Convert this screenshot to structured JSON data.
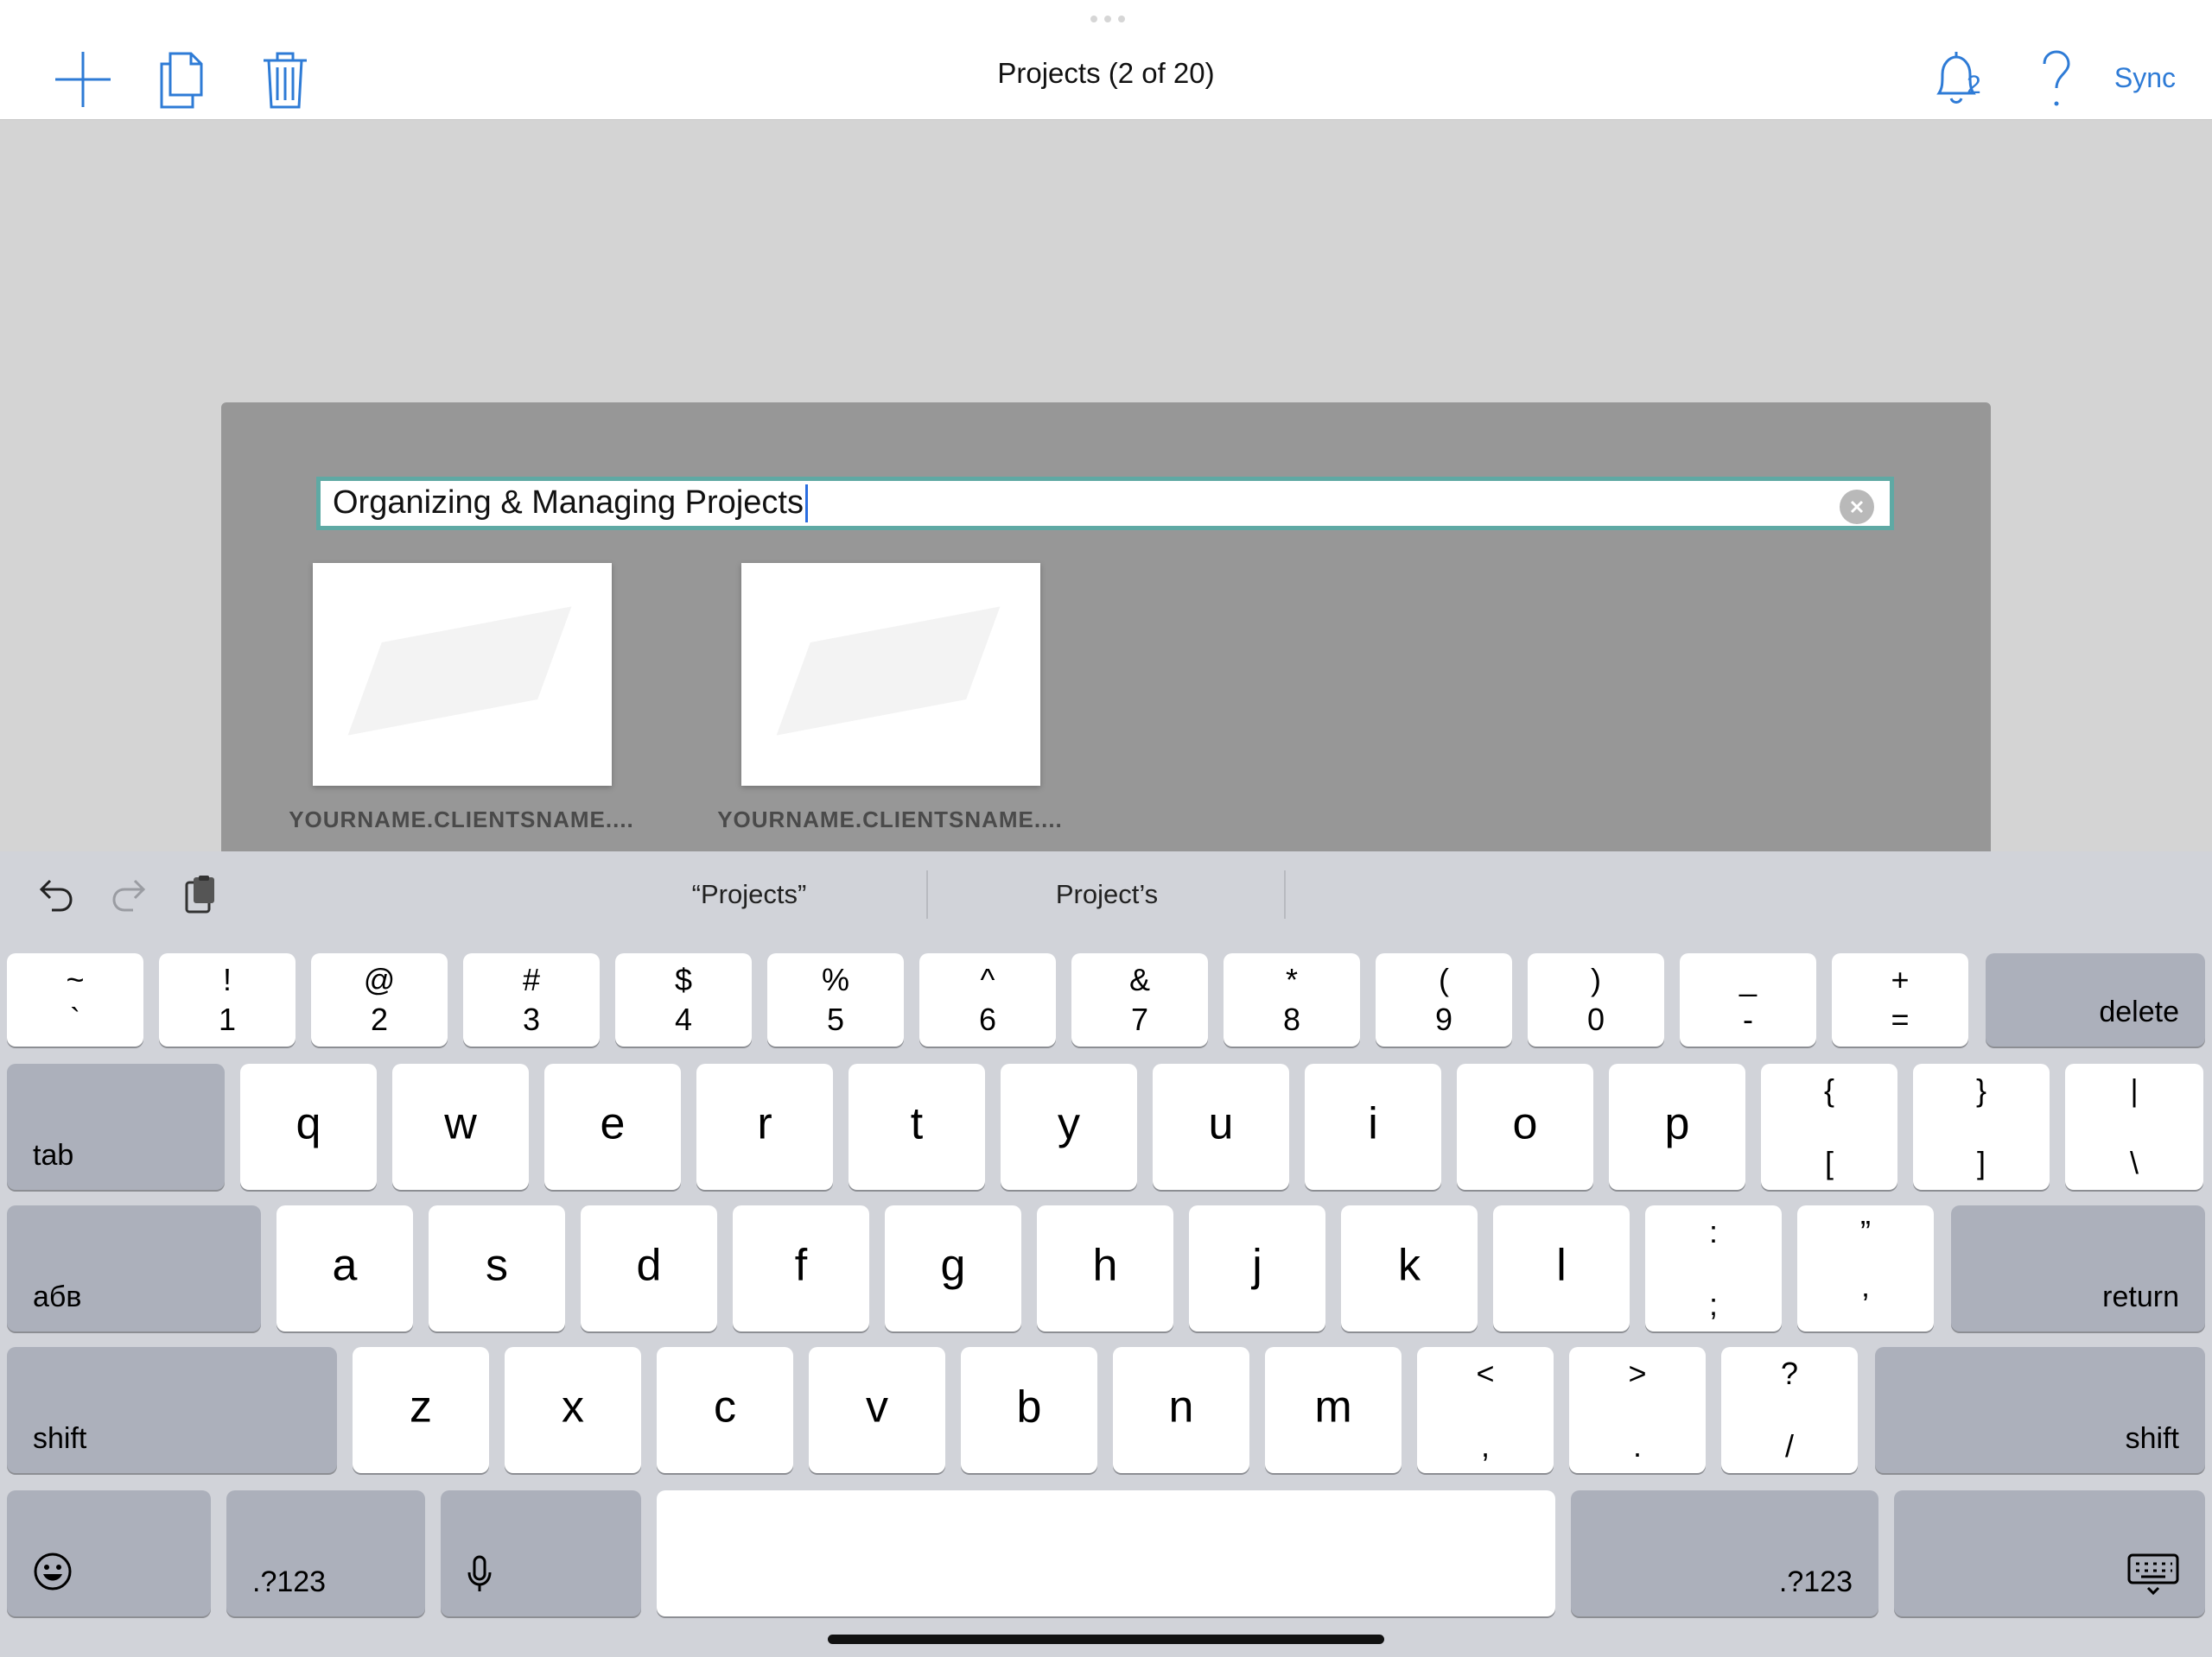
{
  "toolbar": {
    "title": "Projects (2 of 20)",
    "sync_label": "Sync",
    "notification_count": "2",
    "icons": [
      "plus-icon",
      "duplicate-icon",
      "trash-icon",
      "bell-icon",
      "help-icon"
    ]
  },
  "dialog": {
    "name_value": "Organizing & Managing Projects",
    "thumbnails": [
      {
        "label": "YOURNAME.CLIENTSNAME...."
      },
      {
        "label": "YOURNAME.CLIENTSNAME...."
      }
    ]
  },
  "keyboard": {
    "suggestions": [
      "“Projects”",
      "Project’s"
    ],
    "number_row": [
      {
        "upper": "~",
        "lower": "`"
      },
      {
        "upper": "!",
        "lower": "1"
      },
      {
        "upper": "@",
        "lower": "2"
      },
      {
        "upper": "#",
        "lower": "3"
      },
      {
        "upper": "$",
        "lower": "4"
      },
      {
        "upper": "%",
        "lower": "5"
      },
      {
        "upper": "^",
        "lower": "6"
      },
      {
        "upper": "&",
        "lower": "7"
      },
      {
        "upper": "*",
        "lower": "8"
      },
      {
        "upper": "(",
        "lower": "9"
      },
      {
        "upper": ")",
        "lower": "0"
      },
      {
        "upper": "_",
        "lower": "-"
      },
      {
        "upper": "+",
        "lower": "="
      }
    ],
    "delete_label": "delete",
    "tab_label": "tab",
    "row_q": [
      "q",
      "w",
      "e",
      "r",
      "t",
      "y",
      "u",
      "i",
      "o",
      "p"
    ],
    "row_q_symbols": [
      {
        "upper": "{",
        "lower": "["
      },
      {
        "upper": "}",
        "lower": "]"
      },
      {
        "upper": "|",
        "lower": "\\"
      }
    ],
    "lang_label": "абв",
    "row_a": [
      "a",
      "s",
      "d",
      "f",
      "g",
      "h",
      "j",
      "k",
      "l"
    ],
    "row_a_symbols": [
      {
        "upper": ":",
        "lower": ";"
      },
      {
        "upper": "”",
        "lower": "’"
      }
    ],
    "return_label": "return",
    "shift_label": "shift",
    "row_z": [
      "z",
      "x",
      "c",
      "v",
      "b",
      "n",
      "m"
    ],
    "row_z_symbols": [
      {
        "upper": "<",
        "lower": ","
      },
      {
        "upper": ">",
        "lower": "."
      },
      {
        "upper": "?",
        "lower": "/"
      }
    ],
    "numbers_label": ".?123",
    "colors": {
      "key_bg": "#ffffff",
      "special_key_bg": "#acb0bb",
      "keyboard_bg": "#d1d3d9",
      "accent": "#2e7bd6"
    }
  }
}
